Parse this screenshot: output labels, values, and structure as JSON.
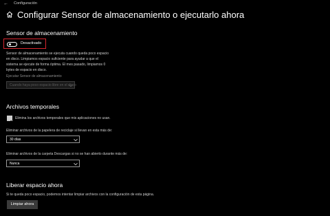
{
  "window": {
    "app_title": "Configuración",
    "back_icon": "arrow-left-icon"
  },
  "header": {
    "home_icon": "home-icon",
    "title": "Configurar Sensor de almacenamiento o ejecutarlo ahora"
  },
  "storage_sense": {
    "title": "Sensor de almacenamiento",
    "toggle_label": "Desactivado",
    "toggle_on": false,
    "description_lines": [
      "Sensor de almacenamiento se ejecuta cuando queda poco espacio",
      "en disco. Limpiamos espacio suficiente para ayudar a que el",
      "sistema se ejecute de forma óptima. El mes pasado, limpiamos 0",
      "bytes de espacio en disco."
    ],
    "run_label": "Ejecutar Sensor de almacenamiento",
    "run_value": "Cuando haya poco espacio libre en el disco"
  },
  "temp_files": {
    "title": "Archivos temporales",
    "checkbox_label": "Elimina los archivos temporales que mis aplicaciones no usan.",
    "checkbox_checked": true,
    "recycle_label": "Eliminar archivos de la papelera de reciclaje si llevan en esta más de:",
    "recycle_value": "30 días",
    "downloads_label": "Eliminar archivos de la carpeta Descargas si no se han abierto durante más de:",
    "downloads_value": "Nunca"
  },
  "free_space": {
    "title": "Liberar espacio ahora",
    "description": "Si te queda poco espacio, podemos intentar limpiar archivos con la configuración de esta página.",
    "button_label": "Limpiar ahora"
  },
  "colors": {
    "background": "#000000",
    "highlight_border": "#d9262e"
  }
}
